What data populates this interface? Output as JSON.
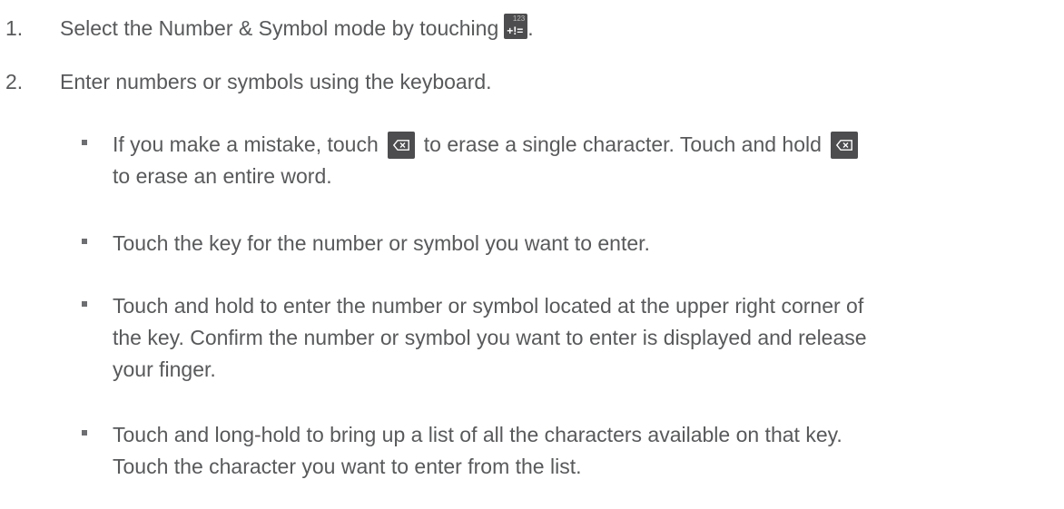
{
  "steps": [
    {
      "number": "1.",
      "text_before": "Select the Number & Symbol mode by touching",
      "icon": "number-symbol-key-icon",
      "icon_small": "123",
      "icon_big": "+!=",
      "text_after": "."
    },
    {
      "number": "2.",
      "text": "Enter numbers or symbols using the keyboard."
    }
  ],
  "bullets": [
    {
      "line1_part1": "If you make a mistake, touch",
      "line1_part2": "to erase a single character. Touch and hold",
      "line2": "to erase an entire word.",
      "icon": "delete-key-icon"
    },
    {
      "text": "Touch the key for the number or symbol you want to enter."
    },
    {
      "line1": "Touch and hold to enter the number or symbol located at the upper right corner of",
      "line2": "the key. Confirm the number or symbol you want to enter is displayed and release",
      "line3": "your finger."
    },
    {
      "line1": "Touch and long-hold to bring up a list of all the characters available on that key.",
      "line2": "Touch the character you want to enter from the list."
    }
  ],
  "colors": {
    "text": "#58595b",
    "key_background": "#4d4d4f"
  }
}
